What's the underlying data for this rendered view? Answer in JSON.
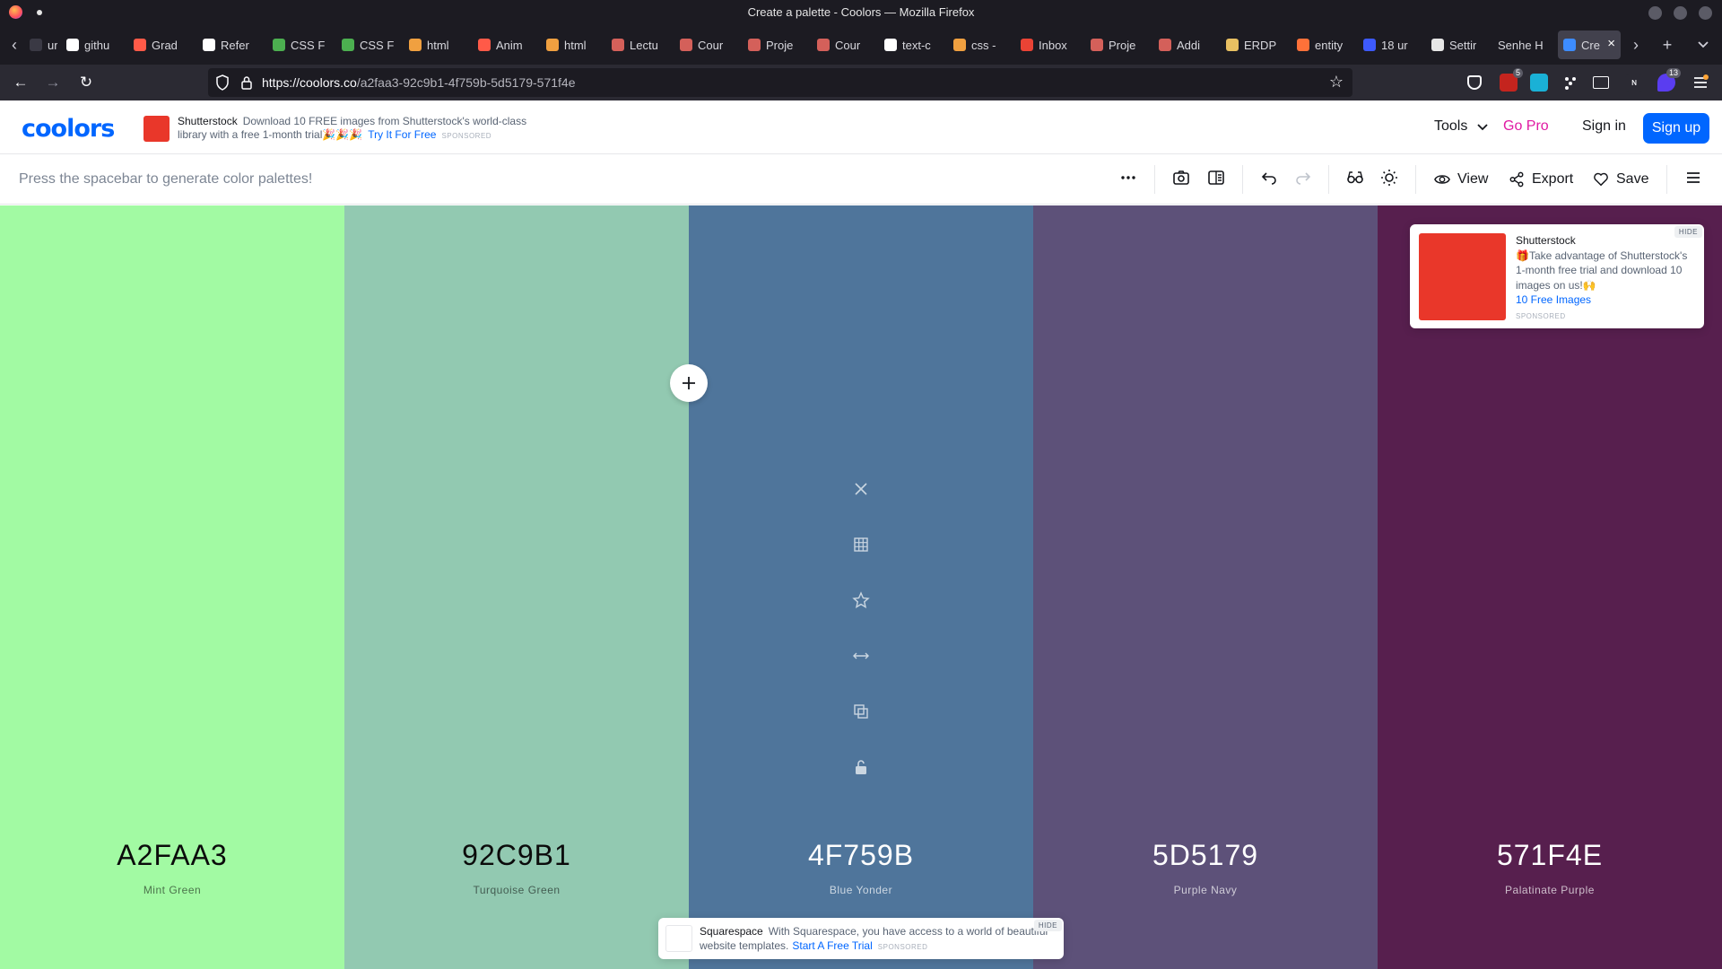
{
  "window": {
    "title": "Create a palette - Coolors — Mozilla Firefox"
  },
  "tabs": [
    {
      "label": "ur",
      "icon": "tab-favicon",
      "color": "#3a3944"
    },
    {
      "label": "githu",
      "icon": "info-icon",
      "color": "#ffffff"
    },
    {
      "label": "Grad",
      "icon": "asterisk-icon",
      "color": "#ff5a48"
    },
    {
      "label": "Refer",
      "icon": "feather-icon",
      "color": "#ffffff"
    },
    {
      "label": "CSS F",
      "icon": "w3-icon",
      "color": "#4caf50"
    },
    {
      "label": "CSS F",
      "icon": "w3-icon",
      "color": "#4caf50"
    },
    {
      "label": "html",
      "icon": "flame-icon",
      "color": "#f0a040"
    },
    {
      "label": "Anim",
      "icon": "asterisk-icon",
      "color": "#ff5a48"
    },
    {
      "label": "html",
      "icon": "flame-icon",
      "color": "#f0a040"
    },
    {
      "label": "Lectu",
      "icon": "scale-icon",
      "color": "#d4605a"
    },
    {
      "label": "Cour",
      "icon": "scale-icon",
      "color": "#d4605a"
    },
    {
      "label": "Proje",
      "icon": "scale-icon",
      "color": "#d4605a"
    },
    {
      "label": "Cour",
      "icon": "scale-icon",
      "color": "#d4605a"
    },
    {
      "label": "text-c",
      "icon": "feather-icon",
      "color": "#ffffff"
    },
    {
      "label": "css -",
      "icon": "flame-icon",
      "color": "#f0a040"
    },
    {
      "label": "Inbox",
      "icon": "gmail-icon",
      "color": "#ea4335"
    },
    {
      "label": "Proje",
      "icon": "scale-icon",
      "color": "#d4605a"
    },
    {
      "label": "Addi",
      "icon": "scale-icon",
      "color": "#d4605a"
    },
    {
      "label": "ERDP",
      "icon": "er-icon",
      "color": "#e8c062"
    },
    {
      "label": "entity",
      "icon": "orange-circle-icon",
      "color": "#ff7139"
    },
    {
      "label": "18 ur",
      "icon": "w-badge-icon",
      "color": "#3d5afe"
    },
    {
      "label": "Settir",
      "icon": "gear-icon",
      "color": "#e6e6e6"
    },
    {
      "label": "Senhe H",
      "icon": "none",
      "color": "#1c1b22"
    },
    {
      "label": "Cre",
      "icon": "coolors-icon",
      "color": "#3d8cff",
      "active": true
    }
  ],
  "nav": {
    "url_domain": "https://coolors.co",
    "url_path": "/a2faa3-92c9b1-4f759b-5d5179-571f4e",
    "extension_badges": {
      "ublock": "5",
      "last": "13"
    }
  },
  "header": {
    "logo": "coolors",
    "ad": {
      "brand": "Shutterstock",
      "text": "Download 10 FREE images from Shutterstock's world-class library with a free 1-month trial🎉🎉🎉",
      "cta": "Try It For Free",
      "sponsored": "SPONSORED"
    },
    "tools": "Tools",
    "go_pro": "Go Pro",
    "sign_in": "Sign in",
    "sign_up": "Sign up"
  },
  "toolbar": {
    "hint": "Press the spacebar to generate color palettes!",
    "view": "View",
    "export": "Export",
    "save": "Save"
  },
  "palette": [
    {
      "hex": "A2FAA3",
      "name": "Mint Green",
      "color": "#A2FAA3",
      "theme": "light"
    },
    {
      "hex": "92C9B1",
      "name": "Turquoise Green",
      "color": "#92C9B1",
      "theme": "light"
    },
    {
      "hex": "4F759B",
      "name": "Blue Yonder",
      "color": "#4F759B",
      "theme": "dark"
    },
    {
      "hex": "5D5179",
      "name": "Purple Navy",
      "color": "#5D5179",
      "theme": "dark"
    },
    {
      "hex": "571F4E",
      "name": "Palatinate Purple",
      "color": "#571F4E",
      "theme": "dark"
    }
  ],
  "ad_right": {
    "brand": "Shutterstock",
    "text": "🎁Take advantage of Shutterstock's 1-month free trial and download 10 images on us!🙌",
    "cta": "10 Free Images",
    "sponsored": "SPONSORED",
    "hide": "HIDE"
  },
  "ad_bottom": {
    "brand": "Squarespace",
    "text": "With Squarespace, you have access to a world of beautiful website templates.",
    "cta": "Start A Free Trial",
    "sponsored": "SPONSORED",
    "hide": "HIDE"
  }
}
